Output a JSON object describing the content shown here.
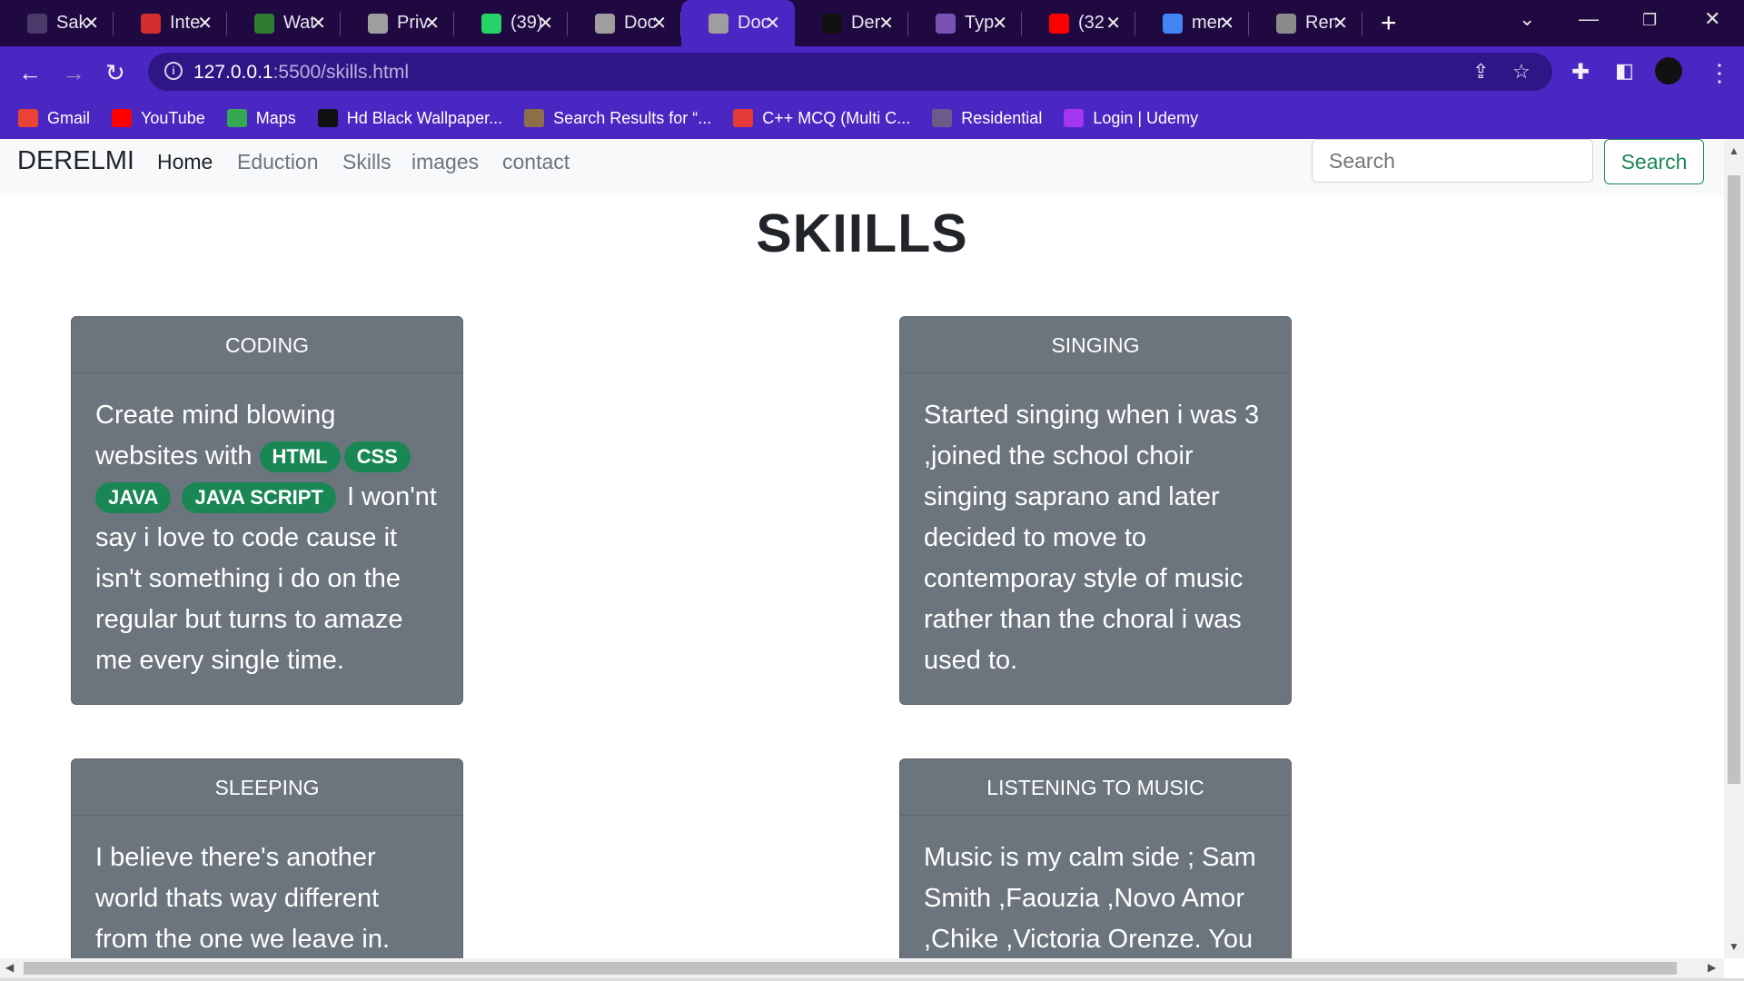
{
  "tabs": [
    {
      "title": "Sak",
      "icon": "site-icon",
      "color": "#4a3a6a"
    },
    {
      "title": "Inte",
      "icon": "speedometer-icon",
      "color": "#d32f2f"
    },
    {
      "title": "Wat",
      "icon": "play-icon",
      "color": "#2e7d32"
    },
    {
      "title": "Priv",
      "icon": "globe-icon",
      "color": "#9e9e9e"
    },
    {
      "title": "(39)",
      "icon": "whatsapp-icon",
      "color": "#25d366"
    },
    {
      "title": "Doc",
      "icon": "globe-icon",
      "color": "#9e9e9e"
    },
    {
      "title": "Doc",
      "icon": "globe-icon",
      "color": "#9e9e9e",
      "active": true
    },
    {
      "title": "Der",
      "icon": "github-icon",
      "color": "#111111"
    },
    {
      "title": "Typ",
      "icon": "bootstrap-icon",
      "color": "#7952b3"
    },
    {
      "title": "(32",
      "icon": "youtube-icon",
      "color": "#ff0000"
    },
    {
      "title": "mer",
      "icon": "google-icon",
      "color": "#4285f4"
    },
    {
      "title": "Ren",
      "icon": "layers-icon",
      "color": "#8a8a8a"
    }
  ],
  "address": {
    "host": "127.0.0.1",
    "path": ":5500/skills.html"
  },
  "bookmarks": [
    {
      "label": "Gmail",
      "icon": "gmail-icon",
      "color": "#ea4335"
    },
    {
      "label": "YouTube",
      "icon": "youtube-icon",
      "color": "#ff0000"
    },
    {
      "label": "Maps",
      "icon": "maps-icon",
      "color": "#34a853"
    },
    {
      "label": "Hd Black Wallpaper...",
      "icon": "wallpaper-icon",
      "color": "#111111"
    },
    {
      "label": "Search Results for “...",
      "icon": "avatar-icon",
      "color": "#8d6e4a"
    },
    {
      "label": "C++ MCQ (Multi C...",
      "icon": "v-logo-icon",
      "color": "#e53935"
    },
    {
      "label": "Residential",
      "icon": "person-icon",
      "color": "#6d5a8a"
    },
    {
      "label": "Login | Udemy",
      "icon": "udemy-icon",
      "color": "#a435f0"
    }
  ],
  "navbar": {
    "brand": "DERELMI",
    "links": [
      "Home",
      "Eduction",
      "Skills",
      "images",
      "contact"
    ],
    "search_placeholder": "Search",
    "search_button": "Search"
  },
  "page": {
    "title": "SKIILLS"
  },
  "cards": [
    {
      "header": "CODING",
      "text_before": "Create mind blowing websites with",
      "badges": [
        "HTML",
        "CSS",
        "JAVA",
        "JAVA SCRIPT"
      ],
      "text_after": "I won'nt say i love to code cause it isn't something i do on the regular but turns to amaze me every single time."
    },
    {
      "header": "SINGING",
      "text": "Started singing when i was 3 ,joined the school choir singing saprano and later decided to move to contemporay style of music rather than the choral i was used to."
    },
    {
      "header": "SLEEPING",
      "text": "I believe there's another world thats way different from the one we leave in. Where we"
    },
    {
      "header": "LISTENING TO MUSIC",
      "text": "Music is my calm side ; Sam Smith ,Faouzia ,Novo Amor ,Chike ,Victoria Orenze. You"
    }
  ],
  "colors": {
    "tabstrip": "#1f0940",
    "toolbar": "#4a27c2",
    "card_bg": "#6c757d",
    "badge_bg": "#198754",
    "search_btn": "#198754"
  }
}
